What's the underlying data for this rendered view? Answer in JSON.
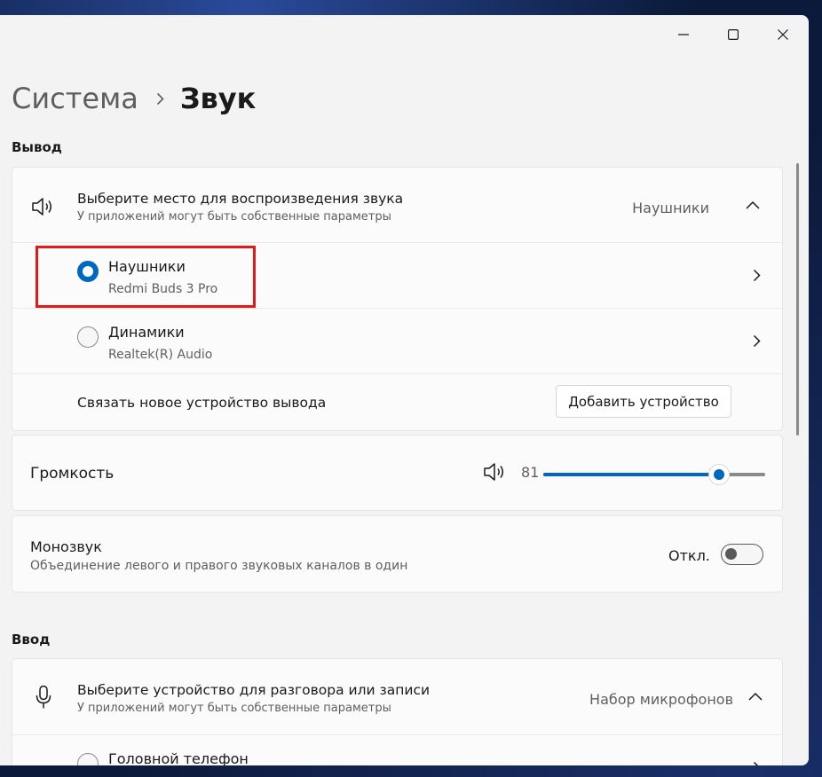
{
  "window": {
    "buttons": {
      "minimize": "minimize-icon",
      "maximize": "maximize-icon",
      "close": "close-icon"
    }
  },
  "breadcrumb": {
    "parent": "Система",
    "separator_icon": "chevron-right-icon",
    "current": "Звук"
  },
  "output": {
    "section_title": "Вывод",
    "selector": {
      "icon": "speaker-icon",
      "title": "Выберите место для воспроизведения звука",
      "subtitle": "У приложений могут быть собственные параметры",
      "selected_value": "Наушники",
      "expand_icon": "chevron-up-icon"
    },
    "devices": [
      {
        "name": "Наушники",
        "detail": "Redmi Buds 3 Pro",
        "selected": true
      },
      {
        "name": "Динамики",
        "detail": "Realtek(R) Audio",
        "selected": false
      }
    ],
    "pair": {
      "label": "Связать новое устройство вывода",
      "button_label": "Добавить устройство"
    },
    "volume": {
      "label": "Громкость",
      "icon": "speaker-volume-icon",
      "value": "81",
      "level": 0.79
    },
    "mono": {
      "title": "Монозвук",
      "subtitle": "Объединение левого и правого звуковых каналов в один",
      "state_label": "Откл.",
      "on": false
    }
  },
  "input": {
    "section_title": "Ввод",
    "selector": {
      "icon": "microphone-icon",
      "title": "Выберите устройство для разговора или записи",
      "subtitle": "У приложений могут быть собственные параметры",
      "selected_value": "Набор микрофонов",
      "expand_icon": "chevron-up-icon"
    },
    "devices": [
      {
        "name": "Головной телефон",
        "selected": false
      }
    ]
  },
  "colors": {
    "accent": "#0067c0",
    "highlight_box": "#e31919"
  }
}
